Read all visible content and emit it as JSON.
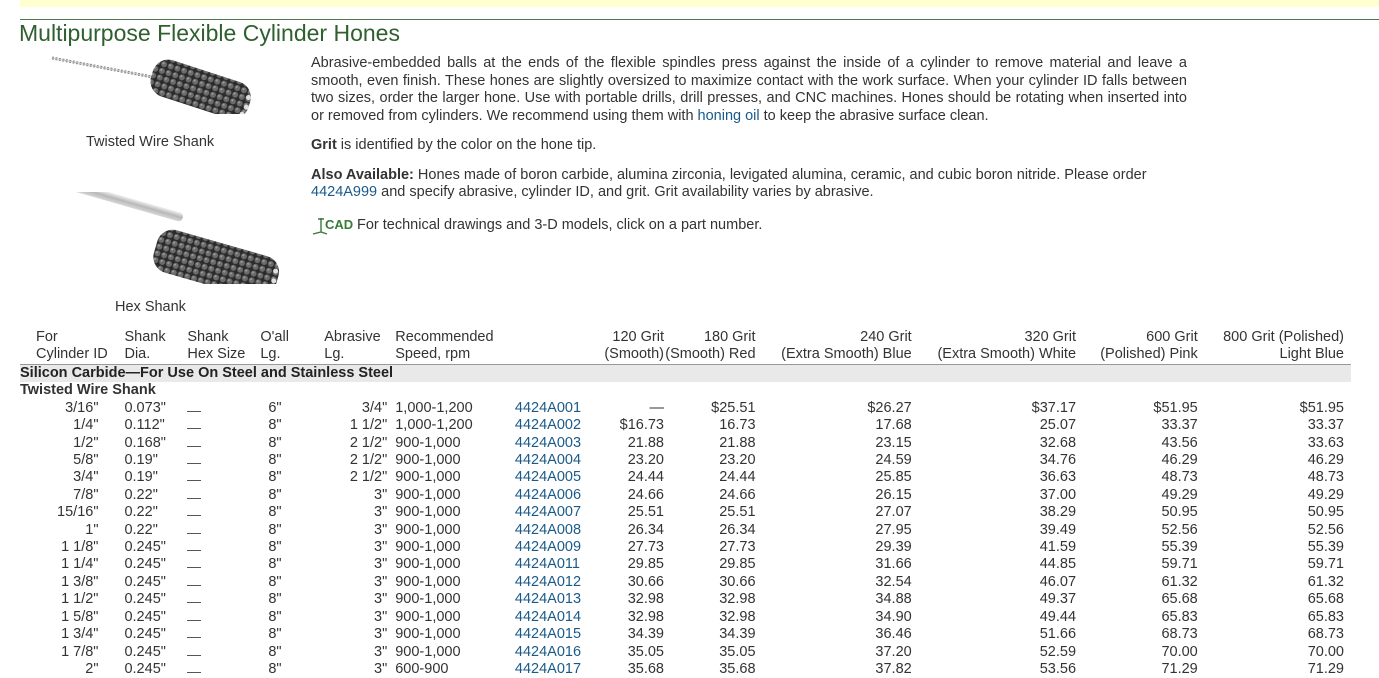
{
  "header": {
    "title": "Multipurpose Flexible Cylinder Hones"
  },
  "images": [
    {
      "caption": "Twisted Wire Shank",
      "icon": "twisted-wire-hone-icon"
    },
    {
      "caption": "Hex Shank",
      "icon": "hex-shank-hone-icon"
    }
  ],
  "description": {
    "p1": "Abrasive-embedded balls at the ends of the flexible spindles press against the inside of a cylinder to remove material and leave a smooth, even finish. These hones are slightly oversized to maximize contact with the work surface. When your cylinder ID falls between two sizes, order the larger hone. Use with portable drills, drill presses, and CNC machines. Hones should be rotating when inserted into or removed from cylinders. We recommend using them with ",
    "p1_link": "honing oil",
    "p1_tail": " to keep the abrasive surface clean.",
    "p2_bold": "Grit",
    "p2_text": " is identified by the color on the hone tip.",
    "p3_bold": "Also Available:",
    "p3_text": " Hones made of boron carbide, alumina zirconia, levigated alumina, ceramic, and cubic boron nitride. Please order ",
    "p3_link": "4424A999",
    "p3_tail": " and specify abrasive, cylinder ID, and grit. Grit availability varies by abrasive.",
    "cad_icon_label": "CAD",
    "p4_text": "For technical drawings and 3-D models, click on a part number."
  },
  "table": {
    "headers": {
      "cyl_1": "For",
      "cyl_2": "Cylinder ID",
      "dia_1": "Shank",
      "dia_2": "Dia.",
      "hex_1": "Shank",
      "hex_2": "Hex Size",
      "oall_1": "O'all",
      "oall_2": "Lg.",
      "abr_1": "Abrasive",
      "abr_2": "Lg.",
      "speed_1": "Recommended",
      "speed_2": "Speed, rpm",
      "g120_1": "120 Grit",
      "g120_2": "(Smooth)",
      "g180_1": "180 Grit",
      "g180_2": "(Smooth) Red",
      "g240_1": "240 Grit",
      "g240_2": "(Extra Smooth) Blue",
      "g320_1": "320 Grit",
      "g320_2": "(Extra Smooth) White",
      "g600_1": "600 Grit",
      "g600_2": "(Polished) Pink",
      "g800_1": "800 Grit (Polished)",
      "g800_2": "Light Blue"
    },
    "section": "Silicon Carbide—For Use On Steel and Stainless Steel",
    "subsection": "Twisted Wire Shank",
    "rows": [
      {
        "cyl": "3/16\"",
        "dia": "0.073\"",
        "oall": "6\"",
        "abr": "3/4\"",
        "speed": "1,000-1,200",
        "pn": "4424A001",
        "g120": "—",
        "g180": "$25.51",
        "g240": "$26.27",
        "g320": "$37.17",
        "g600": "$51.95",
        "g800": "$51.95"
      },
      {
        "cyl": "1/4\"",
        "dia": "0.112\"",
        "oall": "8\"",
        "abr": "1 1/2\"",
        "speed": "1,000-1,200",
        "pn": "4424A002",
        "g120": "$16.73",
        "g180": "16.73",
        "g240": "17.68",
        "g320": "25.07",
        "g600": "33.37",
        "g800": "33.37"
      },
      {
        "cyl": "1/2\"",
        "dia": "0.168\"",
        "oall": "8\"",
        "abr": "2 1/2\"",
        "speed": "900-1,000",
        "pn": "4424A003",
        "g120": "21.88",
        "g180": "21.88",
        "g240": "23.15",
        "g320": "32.68",
        "g600": "43.56",
        "g800": "33.63"
      },
      {
        "cyl": "5/8\"",
        "dia": "0.19\"",
        "oall": "8\"",
        "abr": "2 1/2\"",
        "speed": "900-1,000",
        "pn": "4424A004",
        "g120": "23.20",
        "g180": "23.20",
        "g240": "24.59",
        "g320": "34.76",
        "g600": "46.29",
        "g800": "46.29"
      },
      {
        "cyl": "3/4\"",
        "dia": "0.19\"",
        "oall": "8\"",
        "abr": "2 1/2\"",
        "speed": "900-1,000",
        "pn": "4424A005",
        "g120": "24.44",
        "g180": "24.44",
        "g240": "25.85",
        "g320": "36.63",
        "g600": "48.73",
        "g800": "48.73"
      },
      {
        "cyl": "7/8\"",
        "dia": "0.22\"",
        "oall": "8\"",
        "abr": "3\"",
        "speed": "900-1,000",
        "pn": "4424A006",
        "g120": "24.66",
        "g180": "24.66",
        "g240": "26.15",
        "g320": "37.00",
        "g600": "49.29",
        "g800": "49.29"
      },
      {
        "cyl": "15/16\"",
        "dia": "0.22\"",
        "oall": "8\"",
        "abr": "3\"",
        "speed": "900-1,000",
        "pn": "4424A007",
        "g120": "25.51",
        "g180": "25.51",
        "g240": "27.07",
        "g320": "38.29",
        "g600": "50.95",
        "g800": "50.95"
      },
      {
        "cyl": "1\"",
        "dia": "0.22\"",
        "oall": "8\"",
        "abr": "3\"",
        "speed": "900-1,000",
        "pn": "4424A008",
        "g120": "26.34",
        "g180": "26.34",
        "g240": "27.95",
        "g320": "39.49",
        "g600": "52.56",
        "g800": "52.56"
      },
      {
        "cyl": "1 1/8\"",
        "dia": "0.245\"",
        "oall": "8\"",
        "abr": "3\"",
        "speed": "900-1,000",
        "pn": "4424A009",
        "g120": "27.73",
        "g180": "27.73",
        "g240": "29.39",
        "g320": "41.59",
        "g600": "55.39",
        "g800": "55.39"
      },
      {
        "cyl": "1 1/4\"",
        "dia": "0.245\"",
        "oall": "8\"",
        "abr": "3\"",
        "speed": "900-1,000",
        "pn": "4424A011",
        "g120": "29.85",
        "g180": "29.85",
        "g240": "31.66",
        "g320": "44.85",
        "g600": "59.71",
        "g800": "59.71"
      },
      {
        "cyl": "1 3/8\"",
        "dia": "0.245\"",
        "oall": "8\"",
        "abr": "3\"",
        "speed": "900-1,000",
        "pn": "4424A012",
        "g120": "30.66",
        "g180": "30.66",
        "g240": "32.54",
        "g320": "46.07",
        "g600": "61.32",
        "g800": "61.32"
      },
      {
        "cyl": "1 1/2\"",
        "dia": "0.245\"",
        "oall": "8\"",
        "abr": "3\"",
        "speed": "900-1,000",
        "pn": "4424A013",
        "g120": "32.98",
        "g180": "32.98",
        "g240": "34.88",
        "g320": "49.37",
        "g600": "65.68",
        "g800": "65.68"
      },
      {
        "cyl": "1 5/8\"",
        "dia": "0.245\"",
        "oall": "8\"",
        "abr": "3\"",
        "speed": "900-1,000",
        "pn": "4424A014",
        "g120": "32.98",
        "g180": "32.98",
        "g240": "34.90",
        "g320": "49.44",
        "g600": "65.83",
        "g800": "65.83"
      },
      {
        "cyl": "1 3/4\"",
        "dia": "0.245\"",
        "oall": "8\"",
        "abr": "3\"",
        "speed": "900-1,000",
        "pn": "4424A015",
        "g120": "34.39",
        "g180": "34.39",
        "g240": "36.46",
        "g320": "51.66",
        "g600": "68.73",
        "g800": "68.73"
      },
      {
        "cyl": "1 7/8\"",
        "dia": "0.245\"",
        "oall": "8\"",
        "abr": "3\"",
        "speed": "900-1,000",
        "pn": "4424A016",
        "g120": "35.05",
        "g180": "35.05",
        "g240": "37.20",
        "g320": "52.59",
        "g600": "70.00",
        "g800": "70.00"
      },
      {
        "cyl": "2\"",
        "dia": "0.245\"",
        "oall": "8\"",
        "abr": "3\"",
        "speed": "600-900",
        "pn": "4424A017",
        "g120": "35.68",
        "g180": "35.68",
        "g240": "37.82",
        "g320": "53.56",
        "g600": "71.29",
        "g800": "71.29"
      }
    ]
  }
}
